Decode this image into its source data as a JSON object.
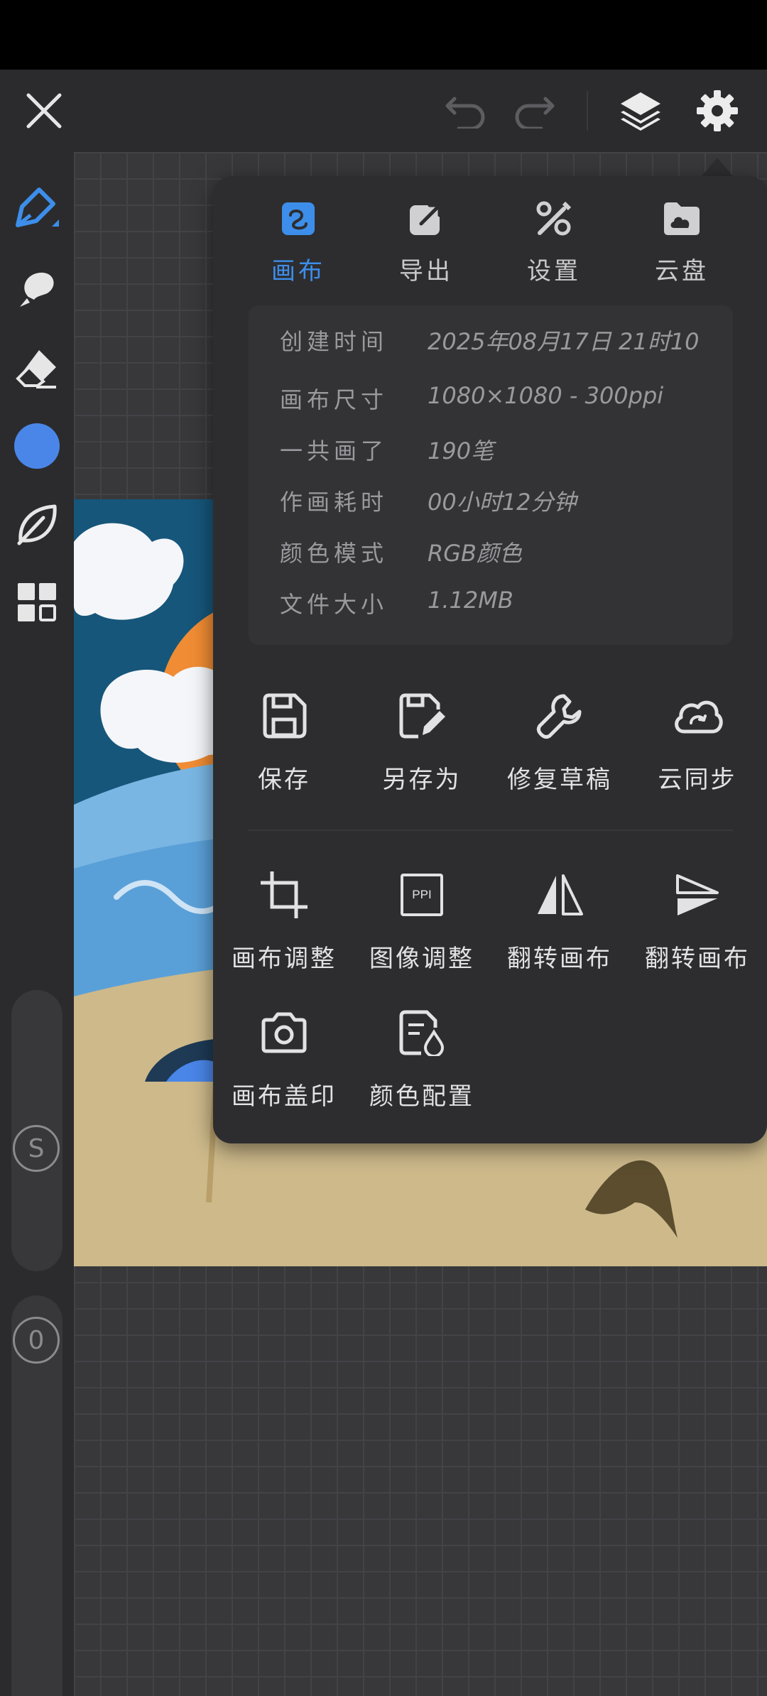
{
  "colors": {
    "accent": "#3d8eea",
    "panel": "#2d2d30",
    "toolbar": "#2b2b2d",
    "brush_color": "#4a86e8"
  },
  "topbar": {
    "icons": [
      "close-icon",
      "undo-icon",
      "redo-icon",
      "layers-icon",
      "settings-icon"
    ]
  },
  "sidebar": {
    "tools": [
      "pen-icon",
      "smudge-icon",
      "eraser-icon",
      "color-swatch",
      "leaf-brush-icon",
      "grid-icon"
    ],
    "size_knob_label": "S",
    "opacity_knob_label": "0"
  },
  "panel": {
    "tabs": [
      {
        "label": "画布",
        "icon": "canvas-icon",
        "active": true
      },
      {
        "label": "导出",
        "icon": "export-icon",
        "active": false
      },
      {
        "label": "设置",
        "icon": "tools-icon",
        "active": false
      },
      {
        "label": "云盘",
        "icon": "cloud-drive-icon",
        "active": false
      }
    ],
    "info": [
      {
        "key": "创建时间",
        "value": "2025年08月17日  21时10"
      },
      {
        "key": "画布尺寸",
        "value": "1080×1080 - 300ppi"
      },
      {
        "key": "一共画了",
        "value": "190笔"
      },
      {
        "key": "作画耗时",
        "value": "00小时12分钟"
      },
      {
        "key": "颜色模式",
        "value": "RGB颜色"
      },
      {
        "key": "文件大小",
        "value": "1.12MB"
      }
    ],
    "actions_row1": [
      {
        "label": "保存",
        "icon": "save-icon"
      },
      {
        "label": "另存为",
        "icon": "save-as-icon"
      },
      {
        "label": "修复草稿",
        "icon": "repair-icon"
      },
      {
        "label": "云同步",
        "icon": "cloud-sync-icon"
      }
    ],
    "actions_row2": [
      {
        "label": "画布调整",
        "icon": "crop-icon"
      },
      {
        "label": "图像调整",
        "icon": "ppi-icon",
        "icon_text": "PPI"
      },
      {
        "label": "翻转画布",
        "icon": "flip-horizontal-icon"
      },
      {
        "label": "翻转画布",
        "icon": "flip-vertical-icon"
      }
    ],
    "actions_row3": [
      {
        "label": "画布盖印",
        "icon": "camera-icon"
      },
      {
        "label": "颜色配置",
        "icon": "color-config-icon"
      }
    ]
  }
}
